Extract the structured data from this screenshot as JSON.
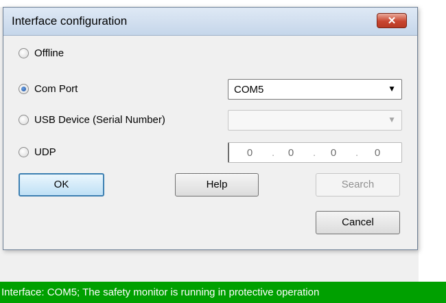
{
  "dialog": {
    "title": "Interface configuration",
    "close_label": "✕",
    "options": [
      {
        "label": "Offline",
        "checked": false
      },
      {
        "label": "Com Port",
        "checked": true
      },
      {
        "label": "USB Device (Serial Number)",
        "checked": false
      },
      {
        "label": "UDP",
        "checked": false
      }
    ],
    "com_port_value": "COM5",
    "usb_device_value": "",
    "udp_ip": [
      "0",
      "0",
      "0",
      "0"
    ],
    "buttons": {
      "ok": "OK",
      "help": "Help",
      "search": "Search",
      "cancel": "Cancel"
    }
  },
  "status": {
    "text": "Interface: COM5; The safety monitor is running in protective operation"
  },
  "colors": {
    "status_bg": "#00a000",
    "title_bg": "#c5d6ea",
    "close_button": "#c8452f"
  }
}
